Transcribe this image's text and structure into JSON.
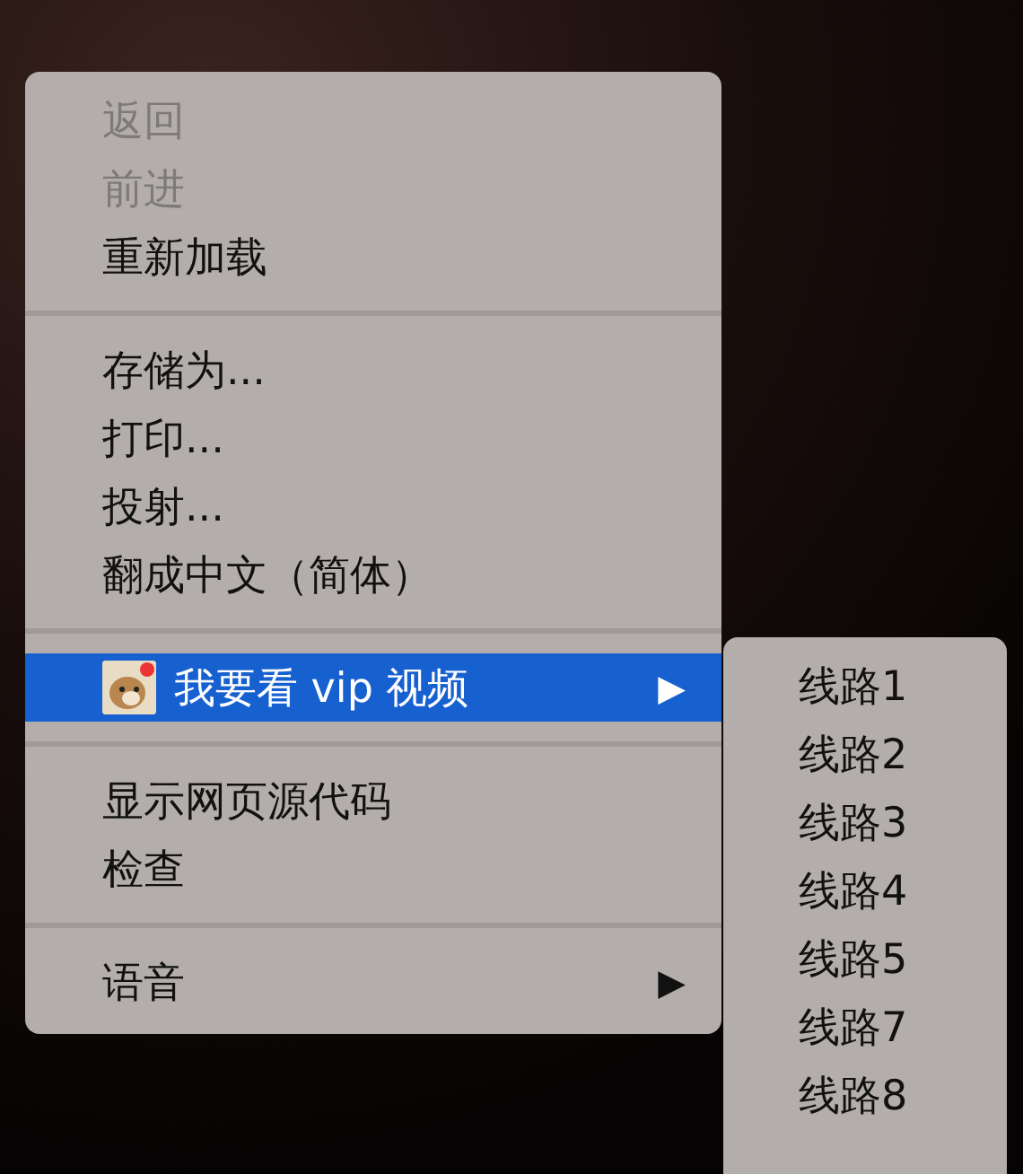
{
  "context_menu": {
    "groups": [
      {
        "items": [
          {
            "label": "返回",
            "disabled": true,
            "selected": false
          },
          {
            "label": "前进",
            "disabled": true,
            "selected": false
          },
          {
            "label": "重新加载",
            "disabled": false,
            "selected": false
          }
        ]
      },
      {
        "items": [
          {
            "label": "存储为...",
            "disabled": false,
            "selected": false
          },
          {
            "label": "打印...",
            "disabled": false,
            "selected": false
          },
          {
            "label": "投射...",
            "disabled": false,
            "selected": false
          },
          {
            "label": "翻成中文（简体）",
            "disabled": false,
            "selected": false
          }
        ]
      },
      {
        "items": [
          {
            "label": "我要看 vip 视频",
            "disabled": false,
            "selected": true,
            "has_icon": true,
            "submenu_arrow": "▶"
          }
        ]
      },
      {
        "items": [
          {
            "label": "显示网页源代码",
            "disabled": false,
            "selected": false
          },
          {
            "label": "检查",
            "disabled": false,
            "selected": false
          }
        ]
      },
      {
        "items": [
          {
            "label": "语音",
            "disabled": false,
            "selected": false,
            "submenu_arrow": "▶"
          }
        ]
      }
    ]
  },
  "submenu": {
    "items": [
      {
        "label": "线路1"
      },
      {
        "label": "线路2"
      },
      {
        "label": "线路3"
      },
      {
        "label": "线路4"
      },
      {
        "label": "线路5"
      },
      {
        "label": "线路7"
      },
      {
        "label": "线路8"
      }
    ]
  }
}
